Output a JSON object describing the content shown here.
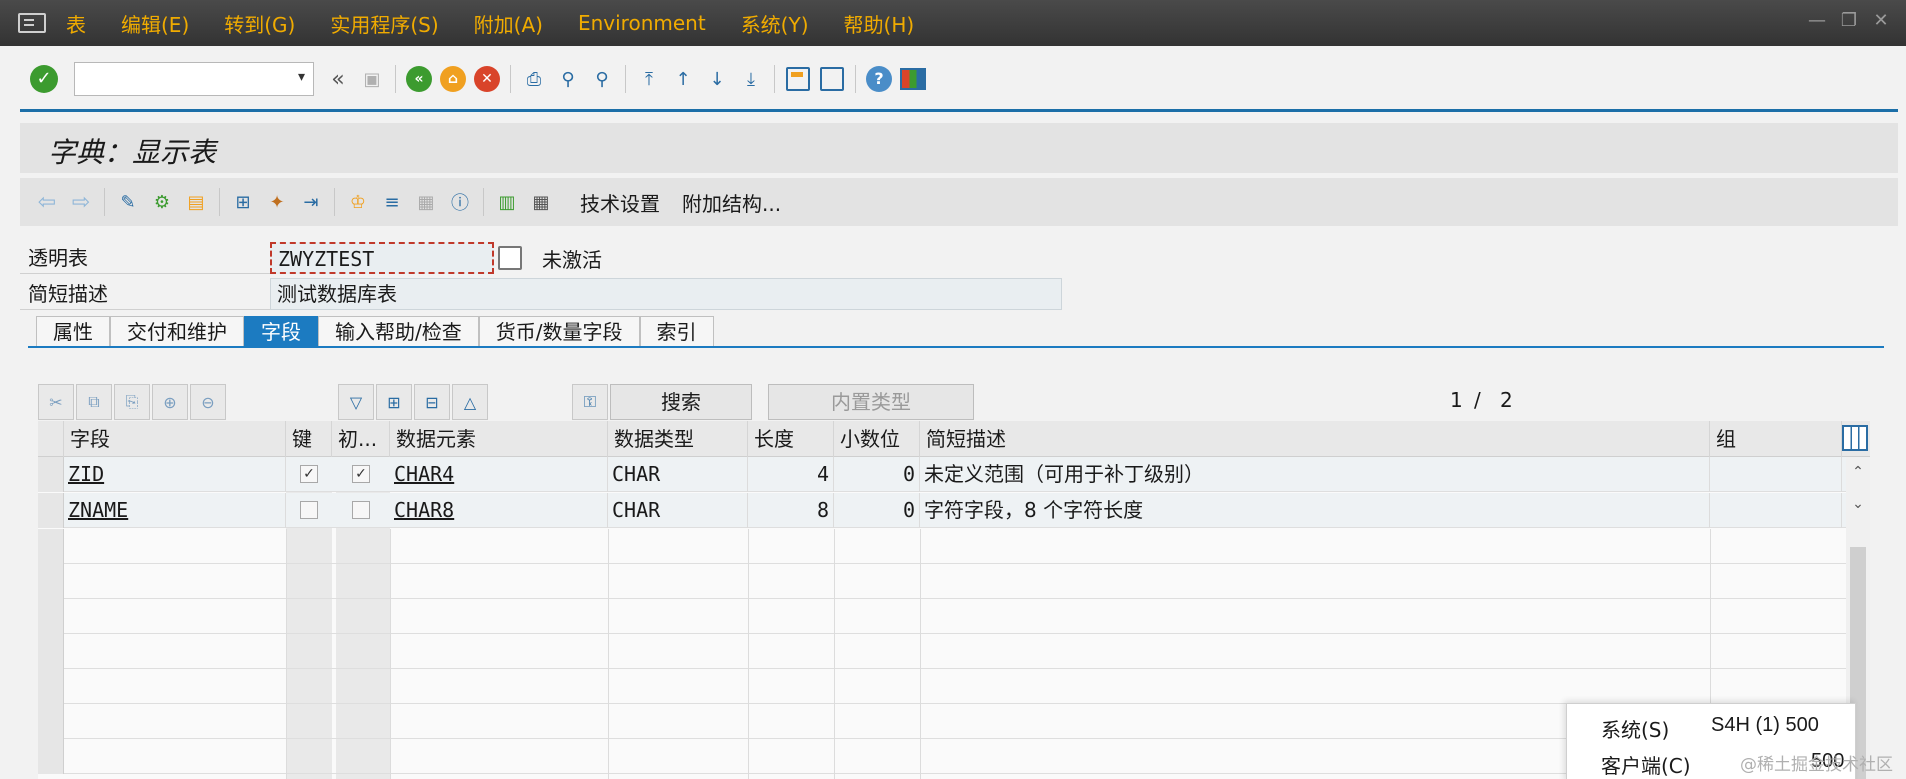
{
  "menu": {
    "items": [
      "表",
      "编辑(E)",
      "转到(G)",
      "实用程序(S)",
      "附加(A)",
      "Environment",
      "系统(Y)",
      "帮助(H)"
    ]
  },
  "window_controls": {
    "minimize": "—",
    "restore": "❐",
    "close": "✕"
  },
  "std_toolbar": {
    "command_field_value": "",
    "back_glyph": "«"
  },
  "title": "字典：显示表",
  "app_toolbar": {
    "tech_settings": "技术设置",
    "append_structure": "附加结构..."
  },
  "header": {
    "table_label": "透明表",
    "table_name": "ZWYZTEST",
    "status": "未激活",
    "desc_label": "简短描述",
    "desc_value": "测试数据库表"
  },
  "tabs": [
    {
      "label": "属性",
      "active": false
    },
    {
      "label": "交付和维护",
      "active": false
    },
    {
      "label": "字段",
      "active": true
    },
    {
      "label": "输入帮助/检查",
      "active": false
    },
    {
      "label": "货币/数量字段",
      "active": false
    },
    {
      "label": "索引",
      "active": false
    }
  ],
  "table_toolbar": {
    "search": "搜索",
    "builtin_type": "内置类型",
    "page_current": "1",
    "page_sep": "/",
    "page_total": "2"
  },
  "grid": {
    "columns": [
      "字段",
      "键",
      "初...",
      "数据元素",
      "数据类型",
      "长度",
      "小数位",
      "简短描述",
      "组"
    ],
    "rows": [
      {
        "field": "ZID",
        "key": true,
        "init": true,
        "data_element": "CHAR4",
        "data_type": "CHAR",
        "length": "4",
        "decimals": "0",
        "description": "未定义范围（可用于补丁级别）",
        "group": ""
      },
      {
        "field": "ZNAME",
        "key": false,
        "init": false,
        "data_element": "CHAR8",
        "data_type": "CHAR",
        "length": "8",
        "decimals": "0",
        "description": "字符字段，8 个字符长度",
        "group": ""
      }
    ]
  },
  "system_popup": {
    "system_label": "系统(S)",
    "system_value": "S4H (1) 500",
    "client_label": "客户端(C)",
    "client_value": "500"
  },
  "watermark": "@稀土掘金技术社区"
}
